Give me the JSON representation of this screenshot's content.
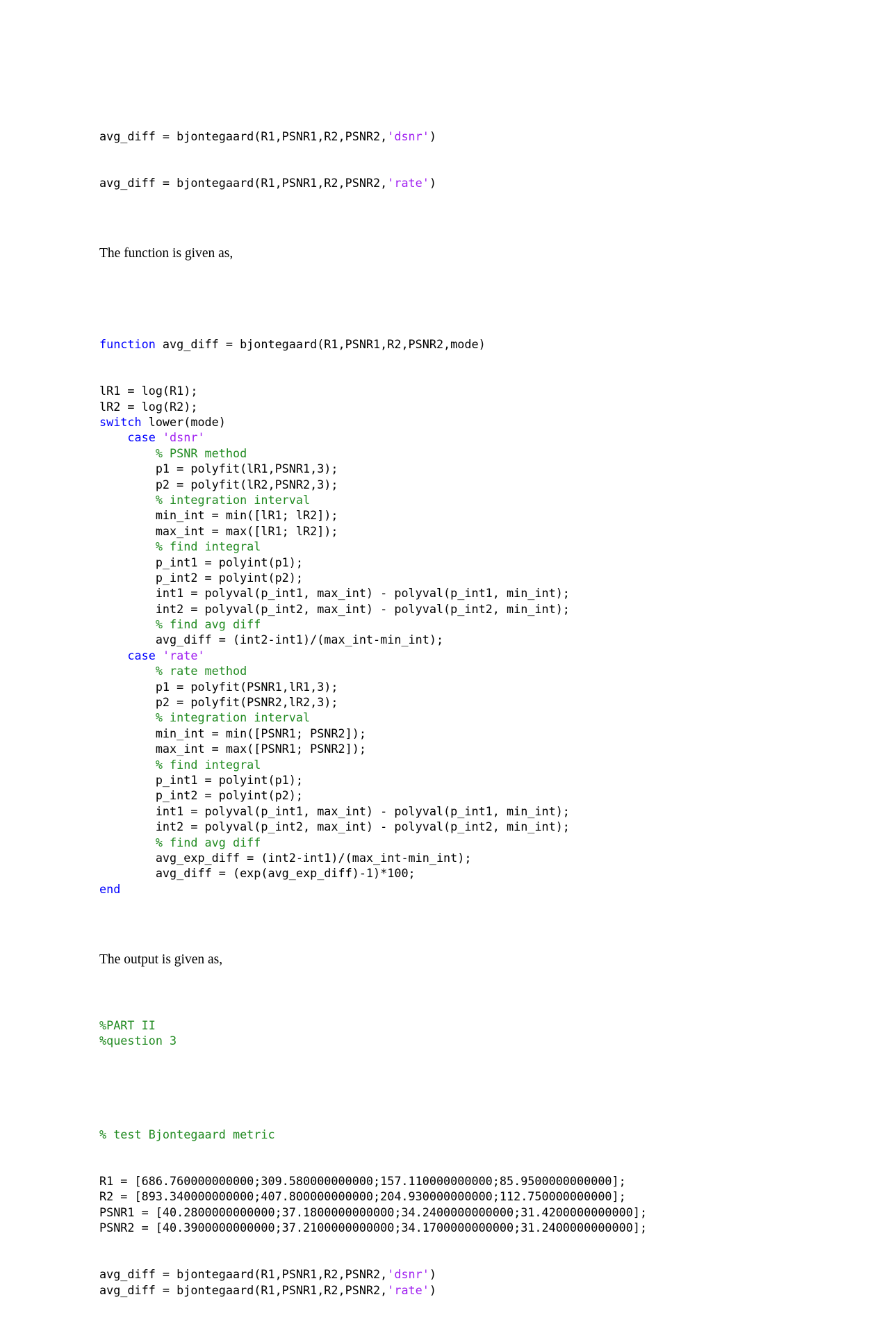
{
  "document": {
    "type": "matlab-code-document",
    "colors": {
      "keyword": "#0000ff",
      "string": "#a020f0",
      "comment": "#228b22",
      "plain": "#000000",
      "background": "#ffffff"
    }
  },
  "top_calls": {
    "line1": {
      "before": "avg_diff = bjontegaard(R1,PSNR1,R2,PSNR2,",
      "string": "'dsnr'",
      "after": ")"
    },
    "line2": {
      "before": "avg_diff = bjontegaard(R1,PSNR1,R2,PSNR2,",
      "string": "'rate'",
      "after": ")"
    }
  },
  "prose": {
    "intro": "The function is given as,",
    "output": "The output is given as,"
  },
  "function_block": {
    "signature": {
      "keyword": "function",
      "rest": " avg_diff = bjontegaard(R1,PSNR1,R2,PSNR2,mode)"
    },
    "lines": [
      {
        "indent": 0,
        "plain": "lR1 = log(R1);"
      },
      {
        "indent": 0,
        "plain": "lR2 = log(R2);"
      },
      {
        "indent": 0,
        "keyword": "switch",
        "plain": " lower(mode)"
      },
      {
        "indent": 1,
        "keyword": "case",
        "plain": " ",
        "string": "'dsnr'"
      },
      {
        "indent": 2,
        "comment": "% PSNR method"
      },
      {
        "indent": 2,
        "plain": "p1 = polyfit(lR1,PSNR1,3);"
      },
      {
        "indent": 2,
        "plain": "p2 = polyfit(lR2,PSNR2,3);"
      },
      {
        "indent": 2,
        "comment": "% integration interval"
      },
      {
        "indent": 2,
        "plain": "min_int = min([lR1; lR2]);"
      },
      {
        "indent": 2,
        "plain": "max_int = max([lR1; lR2]);"
      },
      {
        "indent": 2,
        "comment": "% find integral"
      },
      {
        "indent": 2,
        "plain": "p_int1 = polyint(p1);"
      },
      {
        "indent": 2,
        "plain": "p_int2 = polyint(p2);"
      },
      {
        "indent": 2,
        "plain": "int1 = polyval(p_int1, max_int) - polyval(p_int1, min_int);"
      },
      {
        "indent": 2,
        "plain": "int2 = polyval(p_int2, max_int) - polyval(p_int2, min_int);"
      },
      {
        "indent": 2,
        "comment": "% find avg diff"
      },
      {
        "indent": 2,
        "plain": "avg_diff = (int2-int1)/(max_int-min_int);"
      },
      {
        "indent": 1,
        "keyword": "case",
        "plain": " ",
        "string": "'rate'"
      },
      {
        "indent": 2,
        "comment": "% rate method"
      },
      {
        "indent": 2,
        "plain": "p1 = polyfit(PSNR1,lR1,3);"
      },
      {
        "indent": 2,
        "plain": "p2 = polyfit(PSNR2,lR2,3);"
      },
      {
        "indent": 2,
        "comment": "% integration interval"
      },
      {
        "indent": 2,
        "plain": "min_int = min([PSNR1; PSNR2]);"
      },
      {
        "indent": 2,
        "plain": "max_int = max([PSNR1; PSNR2]);"
      },
      {
        "indent": 2,
        "comment": "% find integral"
      },
      {
        "indent": 2,
        "plain": "p_int1 = polyint(p1);"
      },
      {
        "indent": 2,
        "plain": "p_int2 = polyint(p2);"
      },
      {
        "indent": 2,
        "plain": "int1 = polyval(p_int1, max_int) - polyval(p_int1, min_int);"
      },
      {
        "indent": 2,
        "plain": "int2 = polyval(p_int2, max_int) - polyval(p_int2, min_int);"
      },
      {
        "indent": 2,
        "comment": "% find avg diff"
      },
      {
        "indent": 2,
        "plain": "avg_exp_diff = (int2-int1)/(max_int-min_int);"
      },
      {
        "indent": 2,
        "plain": "avg_diff = (exp(avg_exp_diff)-1)*100;"
      },
      {
        "indent": 0,
        "keyword": "end"
      }
    ]
  },
  "output_block": {
    "header_comments": [
      "%PART II",
      "%question 3"
    ],
    "test_comment": "% test Bjontegaard metric",
    "assignments": [
      "R1 = [686.760000000000;309.580000000000;157.110000000000;85.9500000000000];",
      "R2 = [893.340000000000;407.800000000000;204.930000000000;112.750000000000];",
      "PSNR1 = [40.2800000000000;37.1800000000000;34.2400000000000;31.4200000000000];",
      "PSNR2 = [40.3900000000000;37.2100000000000;34.1700000000000;31.2400000000000];"
    ],
    "calls": [
      {
        "before": "avg_diff = bjontegaard(R1,PSNR1,R2,PSNR2,",
        "string": "'dsnr'",
        "after": ")"
      },
      {
        "before": "avg_diff = bjontegaard(R1,PSNR1,R2,PSNR2,",
        "string": "'rate'",
        "after": ")"
      }
    ]
  }
}
